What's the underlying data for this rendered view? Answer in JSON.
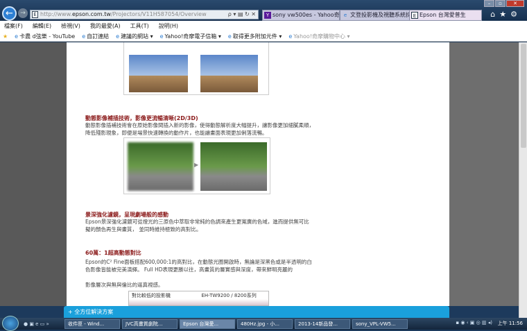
{
  "browser": {
    "url_prefix": "http://www.",
    "url_domain": "epson.com.tw",
    "url_path": "/Projectors/V11H587054/Overview",
    "address_controls": "ρ ▾ ▤ ↻ ✕",
    "tabs": [
      {
        "label": "sony vw500es - Yahoo奇...",
        "icon": "yahoo-icon"
      },
      {
        "label": "文登投影機及視聽系統採...",
        "icon": "ie-icon"
      },
      {
        "label": "Epson 台灣愛普生",
        "icon": "epson-icon",
        "active": true
      }
    ],
    "menu": [
      "檔案(F)",
      "編輯(E)",
      "檢視(V)",
      "我的最愛(A)",
      "工具(T)",
      "說明(H)"
    ],
    "favorites": [
      "卡農 d弦樂 - YouTube",
      "自訂連結",
      "建議的網站 ▾",
      "Yahoo!奇摩電子信箱 ▾",
      "取得更多附加元件 ▾",
      "Yahoo!奇摩購物中心 ▾"
    ]
  },
  "page": {
    "section1": {
      "title": "動態影像補插技術，影像更流暢清晰(2D/3D)",
      "body": "動態影像插補技術會在原始影像間插入新的影像，使得動態解析度大幅提升，讓影像更加細膩柔順，降低殘影現象，即便是場景快速轉換的動作片，也能讓畫面表現更加俐落流暢。"
    },
    "section2": {
      "title": "景深強化濾鏡，呈現劇場般的感動",
      "body": "Epson景深強化濾鏡可從燈光的三原色中萃取非常純的色調來產生更寬廣的色域，進而提供無可比擬的顏色再生與畫質， 並同時維持極致的高對比。"
    },
    "section3": {
      "title": "60萬：1超高動態對比",
      "body1": "Epson的C² Fine面板搭配600,000:1的高對比，在動態光圈開啟時，無論是深黑色或是半透明的白色影像皆能被完美演繹。 Full HD表現更勝以往，高畫質的層實感與深度，帶來鮮明亮麗的",
      "body2": "影像層次與無與倫比的逼真視感。"
    },
    "table_headers": [
      "對比較低的投影機",
      "EH-TW9200 / 8200系列"
    ]
  },
  "bottom_bar": {
    "label": "+ 全方位解決方案"
  },
  "taskbar": {
    "items": [
      "收件匣 - Wind...",
      "JVC高畫質劇院...",
      "Epson 台灣愛...",
      "480Hz.jpg - 小...",
      "2013-14新品發...",
      "sony_VPL-VW5..."
    ],
    "active_index": 2,
    "clock": "上午 11:56"
  }
}
